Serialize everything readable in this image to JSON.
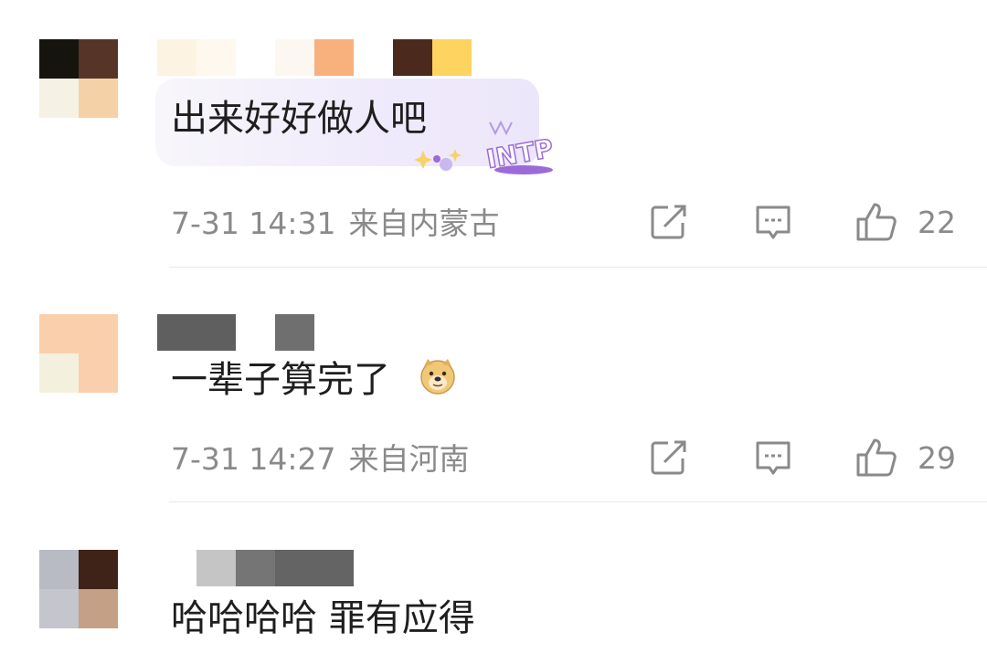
{
  "comments": [
    {
      "text": "出来好好做人吧",
      "time": "7-31 14:31",
      "location": "来自内蒙古",
      "likes": "22",
      "badge_text": "INTP"
    },
    {
      "text": "一辈子算完了",
      "time": "7-31 14:27",
      "location": "来自河南",
      "likes": "29"
    },
    {
      "text": "哈哈哈哈 罪有应得"
    }
  ],
  "colors": {
    "text": "#1e1e1e",
    "meta": "#8a8a8a",
    "divider": "#e9e9e9",
    "badge": "#9b6bd8"
  },
  "icons": [
    "share-icon",
    "comment-icon",
    "like-icon",
    "doge-emoji-icon"
  ]
}
